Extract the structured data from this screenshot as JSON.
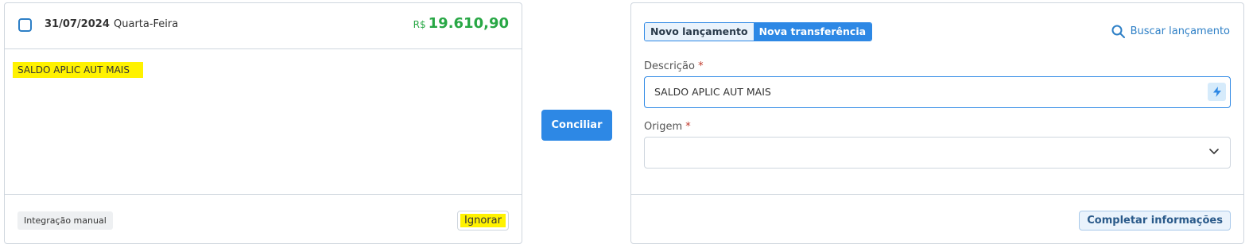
{
  "transaction": {
    "date": "31/07/2024",
    "weekday": "Quarta-Feira",
    "currency": "R$",
    "amount": "19.610,90",
    "description": "SALDO APLIC AUT MAIS",
    "integration_tag": "Integração manual",
    "ignore_label": "Ignorar"
  },
  "actions": {
    "conciliar_label": "Conciliar"
  },
  "form": {
    "tabs": [
      {
        "label": "Novo lançamento",
        "active": false
      },
      {
        "label": "Nova transferência",
        "active": true
      }
    ],
    "search_label": "Buscar lançamento",
    "description_label": "Descrição",
    "description_value": "SALDO APLIC AUT MAIS",
    "origem_label": "Origem",
    "origem_value": "",
    "required_mark": "*",
    "complete_label": "Completar informações"
  },
  "colors": {
    "accent": "#2d88e5",
    "amount_positive": "#28a745",
    "highlight": "#fff200",
    "required": "#c0392b"
  }
}
